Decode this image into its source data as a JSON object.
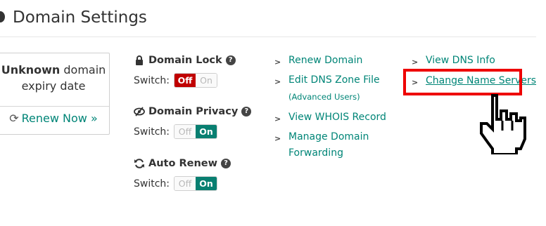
{
  "header": {
    "title": "Domain Settings"
  },
  "expiry": {
    "bold_text": "Unknown",
    "rest_text": " domain expiry date",
    "renew_label": "Renew Now »"
  },
  "settings": [
    {
      "title": "Domain Lock",
      "switch_label": "Switch:",
      "off_label": "Off",
      "on_label": "On",
      "state": "off"
    },
    {
      "title": "Domain Privacy",
      "switch_label": "Switch:",
      "off_label": "Off",
      "on_label": "On",
      "state": "on"
    },
    {
      "title": "Auto Renew",
      "switch_label": "Switch:",
      "off_label": "Off",
      "on_label": "On",
      "state": "on"
    }
  ],
  "links_col1": [
    {
      "label": "Renew Domain"
    },
    {
      "label": "Edit DNS Zone File",
      "sublabel": "(Advanced Users)"
    },
    {
      "label": "View WHOIS Record"
    },
    {
      "label": "Manage Domain",
      "label2": "Forwarding"
    }
  ],
  "links_col2": [
    {
      "label": "View DNS Info"
    },
    {
      "label": "Change Name Servers"
    }
  ],
  "colors": {
    "accent": "#008577",
    "off_red": "#c00000",
    "on_green": "#087f71",
    "highlight": "#ee0000"
  }
}
